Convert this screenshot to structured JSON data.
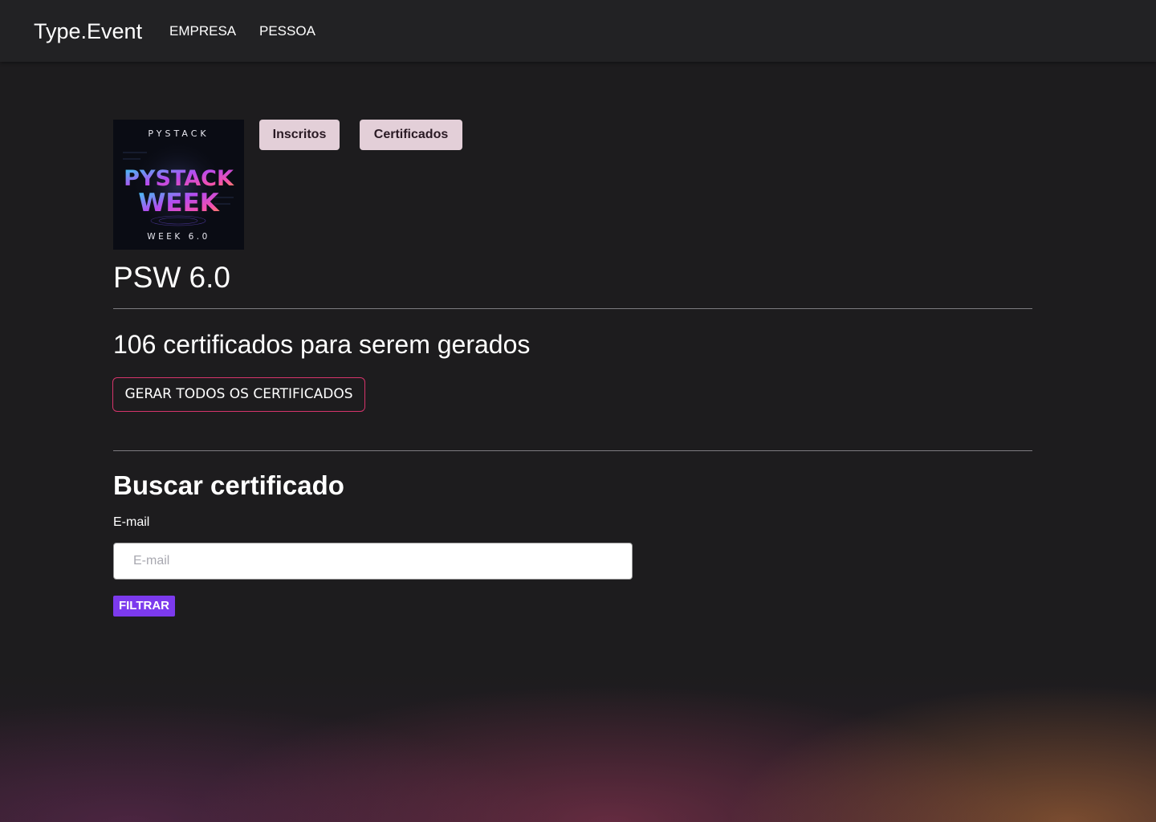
{
  "navbar": {
    "brand": "Type.Event",
    "links": [
      "EMPRESA",
      "PESSOA"
    ]
  },
  "event": {
    "title": "PSW 6.0",
    "poster": {
      "top_text": "PYSTACK",
      "logo_line_1": "PYSTACK",
      "logo_line_2": "WEEK",
      "bottom_text": "WEEK 6.0"
    }
  },
  "tabs": {
    "inscritos_label": "Inscritos",
    "certificados_label": "Certificados"
  },
  "certificates": {
    "count_text": "106 certificados para serem gerados",
    "generate_all_label": "GERAR TODOS OS CERTIFICADOS"
  },
  "search": {
    "title": "Buscar certificado",
    "email_label": "E-mail",
    "email_placeholder": "E-mail",
    "filter_label": "FILTRAR"
  },
  "colors": {
    "background": "#1d1c1e",
    "navbar": "#222224",
    "pill_button": "#e3cfd8",
    "outline_button_border": "#d6346b",
    "filter_button": "#7c3aed"
  }
}
